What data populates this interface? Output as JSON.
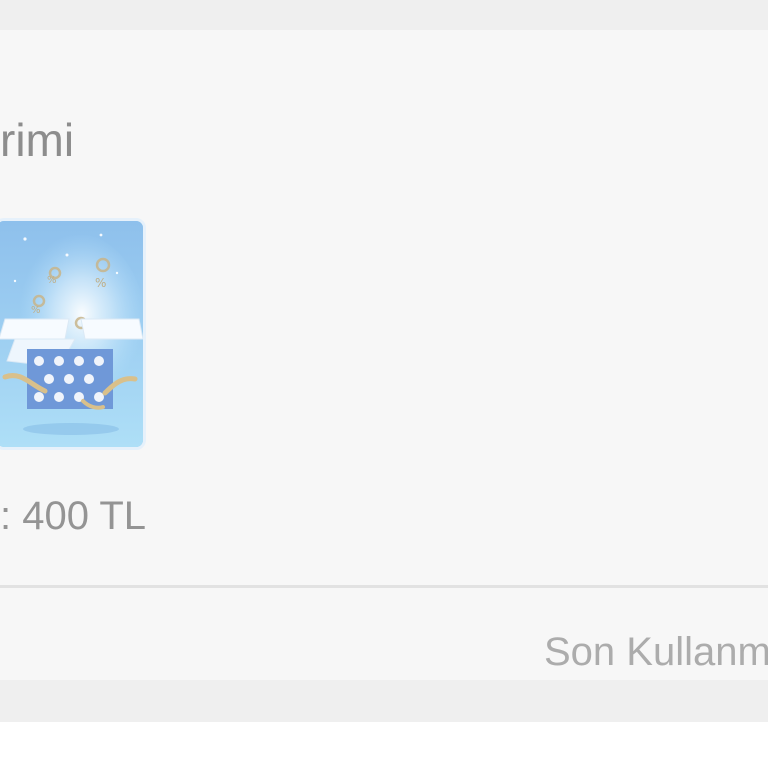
{
  "coupon": {
    "title_text": "rimi",
    "image_icon": "gift-box-illustration",
    "amount_text": ": 400 TL",
    "expiry_text": "Son Kullanm"
  },
  "colors": {
    "card_background": "#f7f7f7",
    "page_strip": "#efefef",
    "title_text": "#8d8d8d",
    "amount_text": "#949494",
    "expiry_text": "#acacac",
    "thumb_background": "#9fd0f2"
  }
}
